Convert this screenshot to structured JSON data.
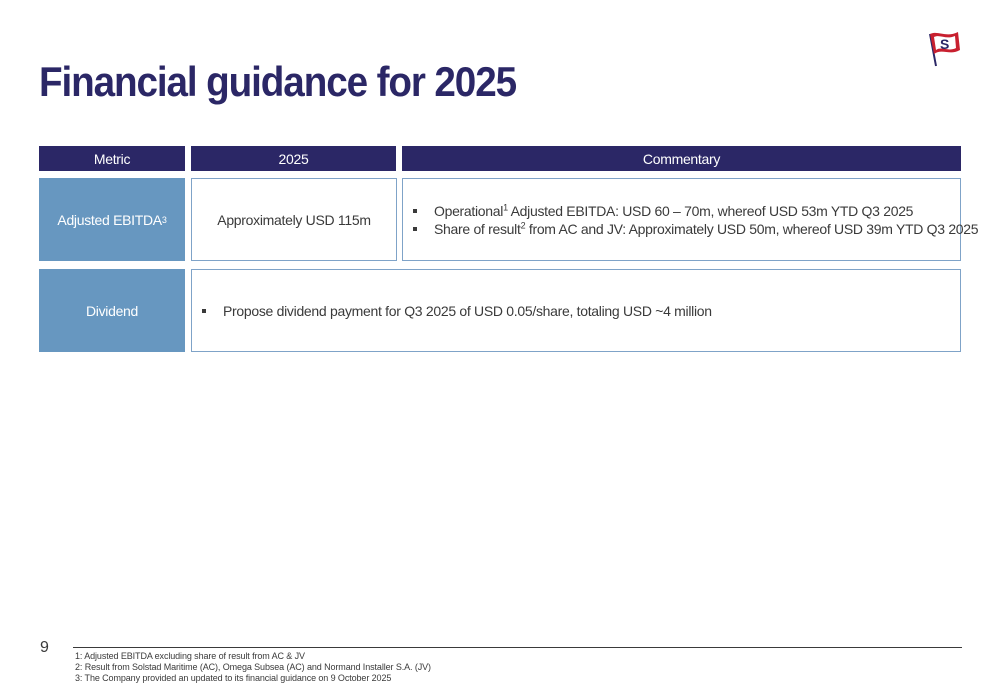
{
  "slide": {
    "title": "Financial guidance for 2025",
    "page_number": "9"
  },
  "logo": {
    "icon": "flag-s-logo-icon",
    "letter": "S",
    "colors": {
      "flag": "#c8202f",
      "pole": "#2b2766"
    }
  },
  "table": {
    "headers": {
      "metric": "Metric",
      "year": "2025",
      "commentary": "Commentary"
    },
    "rows": {
      "ebitda": {
        "metric": "Adjusted EBITDA",
        "metric_sup": "3",
        "value": "Approximately USD 115m",
        "bullets": [
          {
            "pre": "Operational",
            "sup": "1",
            "post": " Adjusted EBITDA: USD 60 – 70m, whereof USD 53m YTD Q3 2025"
          },
          {
            "pre": "Share of result",
            "sup": "2",
            "post": " from AC and JV: Approximately USD 50m, whereof USD 39m YTD Q3 2025"
          }
        ]
      },
      "dividend": {
        "metric": "Dividend",
        "bullet": "Propose dividend payment for Q3 2025 of USD 0.05/share, totaling USD ~4 million"
      }
    }
  },
  "footnotes": [
    "1: Adjusted EBITDA excluding share of result from AC & JV",
    "2: Result from Solstad Maritime (AC), Omega Subsea (AC) and Normand Installer S.A. (JV)",
    "3: The Company provided an updated to its financial guidance on 9 October 2025"
  ],
  "colors": {
    "title": "#2b2766",
    "header_bg": "#2b2766",
    "metric_bg": "#6797c0",
    "border": "#7fa3c8"
  }
}
